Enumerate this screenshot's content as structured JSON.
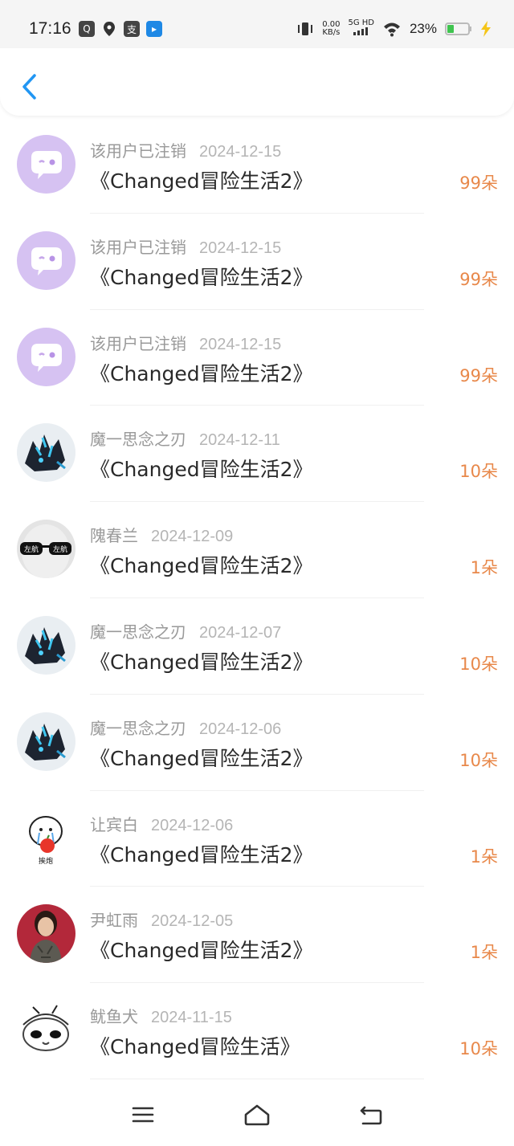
{
  "status_bar": {
    "time": "17:16",
    "net_speed_value": "0.00",
    "net_speed_unit": "KB/s",
    "signal_label": "5G HD",
    "battery_percent": "23%"
  },
  "header": {
    "back_icon": "chevron-left-icon"
  },
  "records": [
    {
      "name": "该用户已注销",
      "date": "2024-12-15",
      "title": "《Changed冒险生活2》",
      "amount": "99朵",
      "avatar": "deleted"
    },
    {
      "name": "该用户已注销",
      "date": "2024-12-15",
      "title": "《Changed冒险生活2》",
      "amount": "99朵",
      "avatar": "deleted"
    },
    {
      "name": "该用户已注销",
      "date": "2024-12-15",
      "title": "《Changed冒险生活2》",
      "amount": "99朵",
      "avatar": "deleted"
    },
    {
      "name": "魔一思念之刃",
      "date": "2024-12-11",
      "title": "《Changed冒险生活2》",
      "amount": "10朵",
      "avatar": "dragon"
    },
    {
      "name": "隗春兰",
      "date": "2024-12-09",
      "title": "《Changed冒险生活2》",
      "amount": "1朵",
      "avatar": "glasses"
    },
    {
      "name": "魔一思念之刃",
      "date": "2024-12-07",
      "title": "《Changed冒险生活2》",
      "amount": "10朵",
      "avatar": "dragon"
    },
    {
      "name": "魔一思念之刃",
      "date": "2024-12-06",
      "title": "《Changed冒险生活2》",
      "amount": "10朵",
      "avatar": "dragon"
    },
    {
      "name": "让宾白",
      "date": "2024-12-06",
      "title": "《Changed冒险生活2》",
      "amount": "1朵",
      "avatar": "cartoon"
    },
    {
      "name": "尹虹雨",
      "date": "2024-12-05",
      "title": "《Changed冒险生活2》",
      "amount": "1朵",
      "avatar": "portrait"
    },
    {
      "name": "鱿鱼犬",
      "date": "2024-11-15",
      "title": "《Changed冒险生活》",
      "amount": "10朵",
      "avatar": "creature"
    }
  ],
  "avatar_text": {
    "glasses_left": "左航",
    "glasses_right": "左航",
    "cartoon_caption": "挨炮"
  },
  "colors": {
    "amount": "#e8884a",
    "back_icon": "#2196f3",
    "deleted_avatar_bg": "#d6c2f2"
  },
  "nav_bar": {
    "menu_icon": "menu-icon",
    "home_icon": "home-icon",
    "back_icon": "back-icon"
  }
}
